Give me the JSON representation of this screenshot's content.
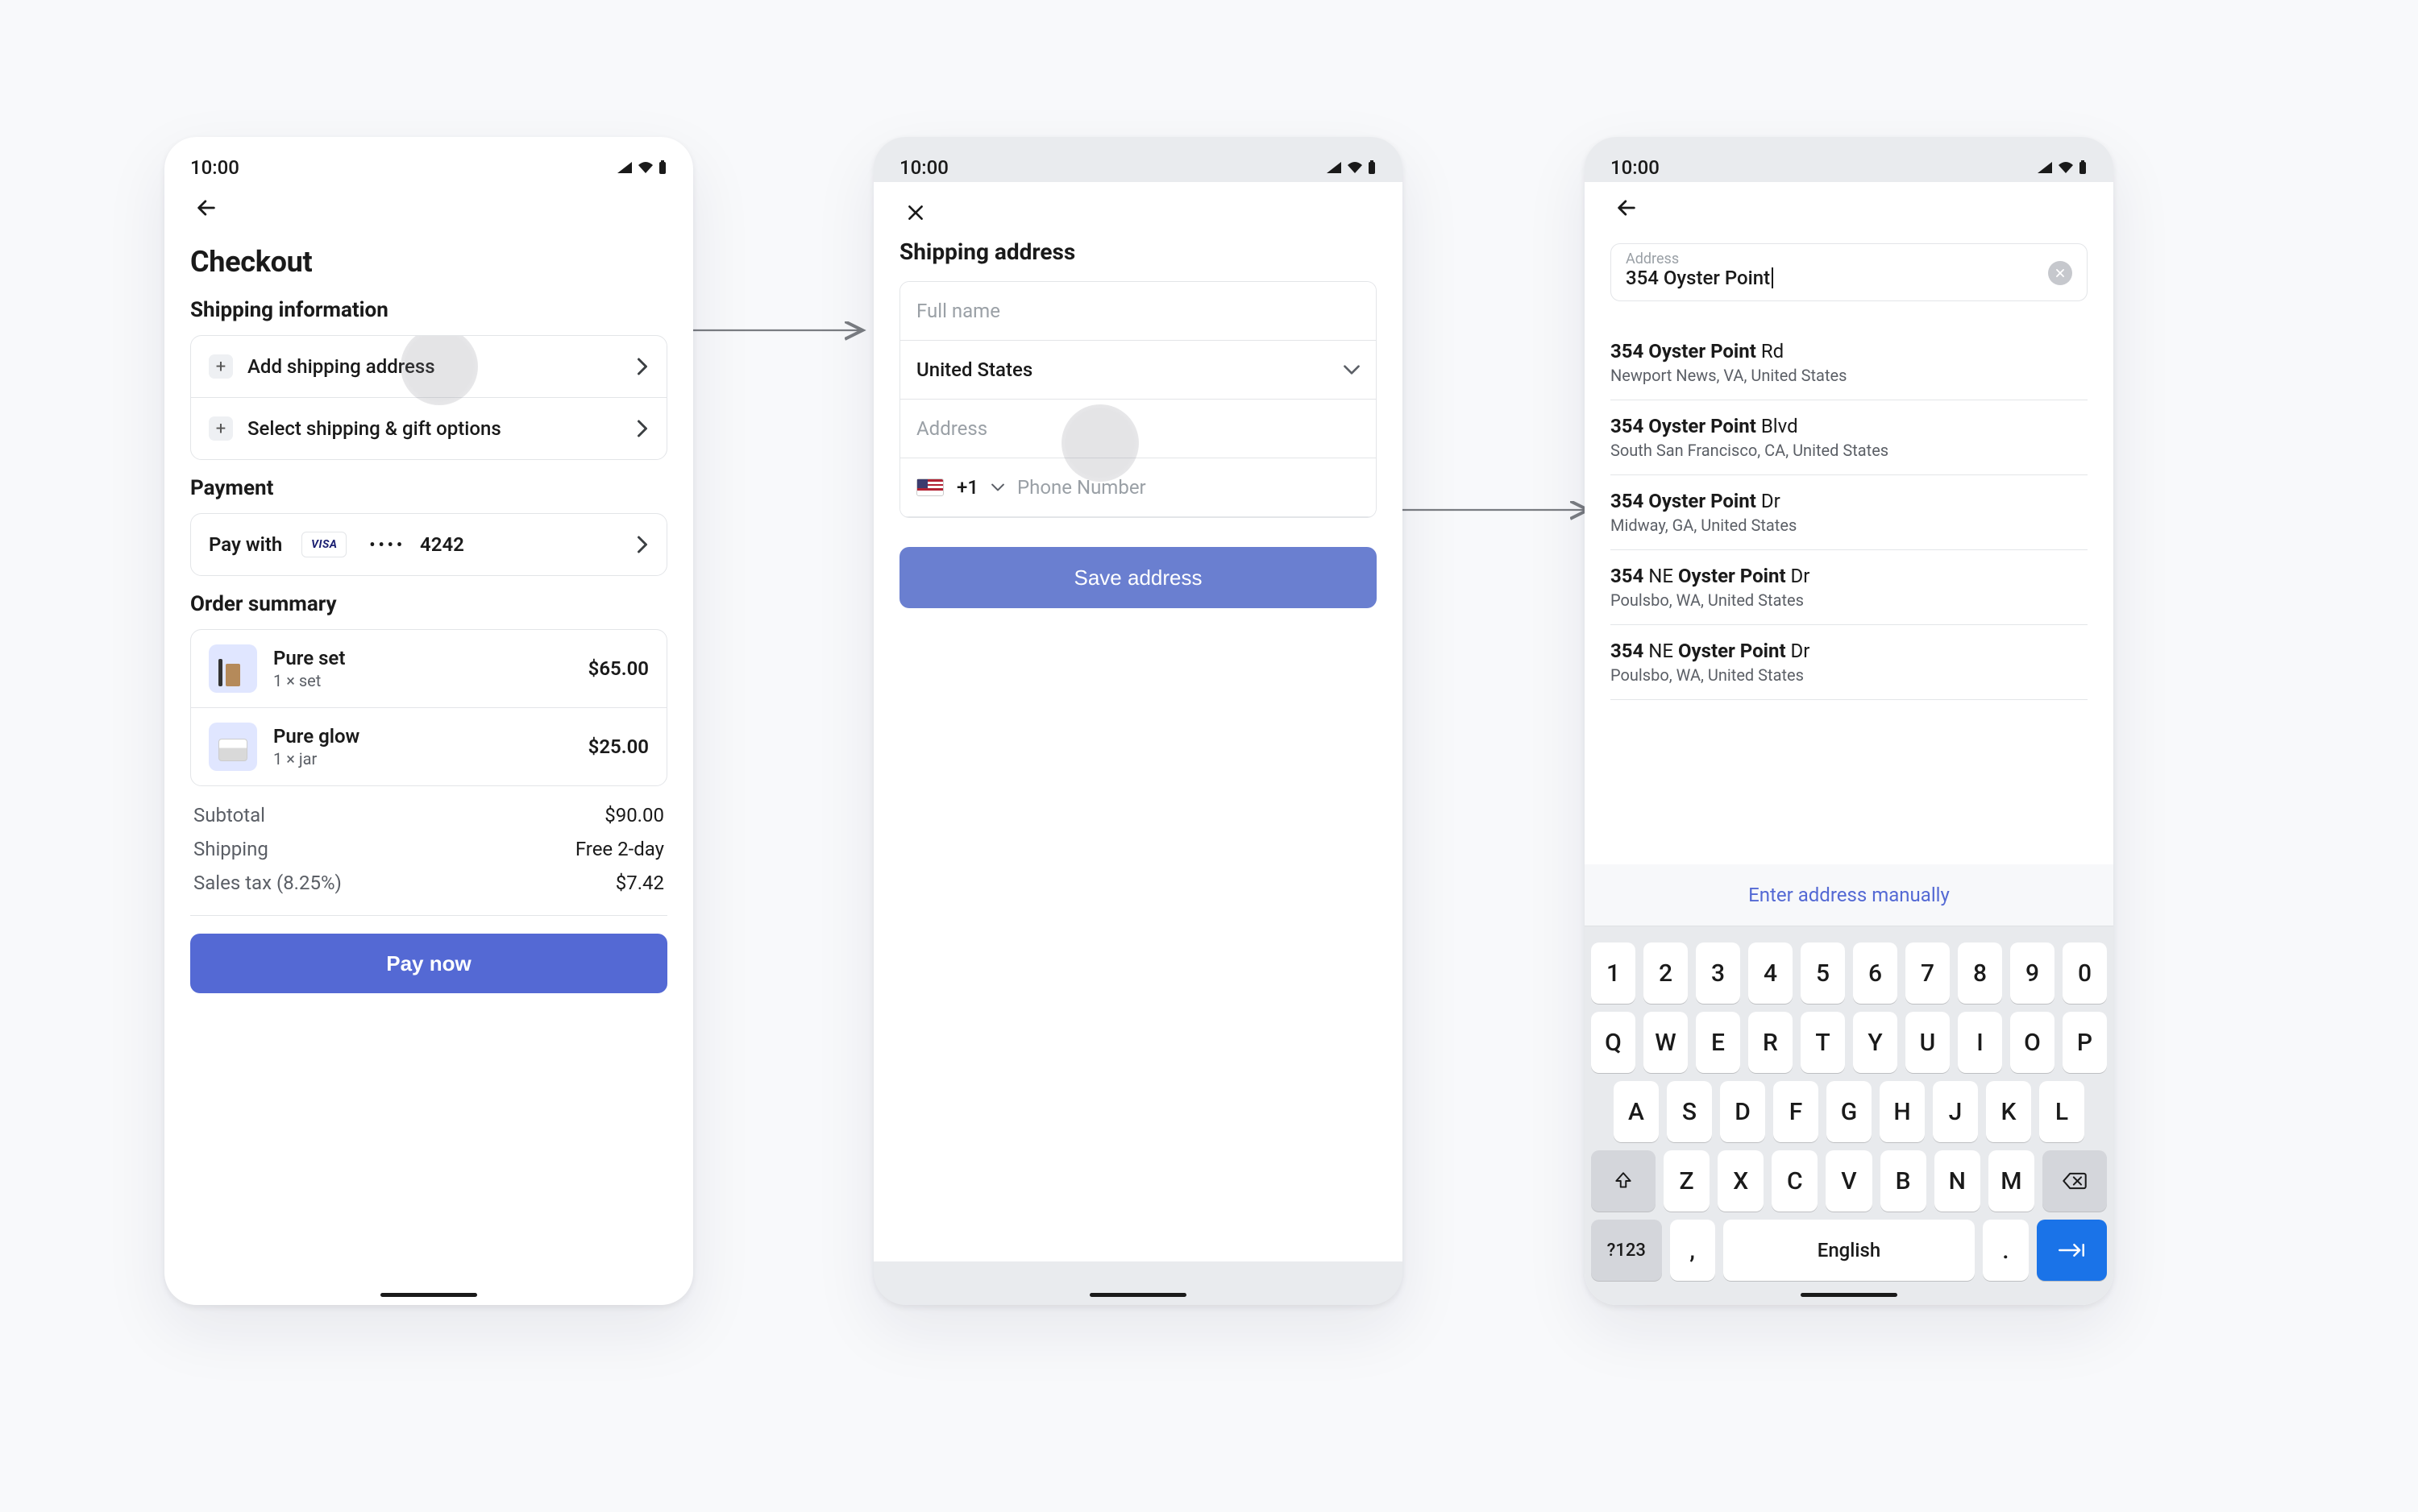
{
  "status_time": "10:00",
  "screen1": {
    "title": "Checkout",
    "shipping_title": "Shipping information",
    "add_address": "Add shipping address",
    "ship_options": "Select shipping & gift options",
    "payment_title": "Payment",
    "pay_with_label": "Pay with",
    "card_brand": "VISA",
    "card_dots": "••••",
    "card_last4": "4242",
    "order_title": "Order summary",
    "items": [
      {
        "name": "Pure set",
        "qty": "1 × set",
        "price": "$65.00"
      },
      {
        "name": "Pure glow",
        "qty": "1 × jar",
        "price": "$25.00"
      }
    ],
    "subtotal_label": "Subtotal",
    "subtotal_value": "$90.00",
    "shipping_label": "Shipping",
    "shipping_value": "Free 2-day",
    "tax_label": "Sales tax (8.25%)",
    "tax_value": "$7.42",
    "pay_button": "Pay now"
  },
  "screen2": {
    "title": "Shipping address",
    "full_name_placeholder": "Full name",
    "country_value": "United States",
    "address_placeholder": "Address",
    "dial_code": "+1",
    "phone_placeholder": "Phone Number",
    "save_button": "Save address"
  },
  "screen3": {
    "input_label": "Address",
    "input_value": "354 Oyster Point",
    "results": [
      {
        "main_bold": "354 Oyster Point",
        "main_rest": " Rd",
        "sub": "Newport News, VA, United States"
      },
      {
        "main_bold": "354 Oyster Point",
        "main_rest": " Blvd",
        "sub": "South San Francisco, CA, United States"
      },
      {
        "main_bold": "354 Oyster Point",
        "main_rest": " Dr",
        "sub": "Midway, GA, United States"
      },
      {
        "main_pre": "354",
        "main_mid": " NE ",
        "main_bold2": "Oyster Point",
        "main_rest": " Dr",
        "sub": "Poulsbo, WA, United States"
      },
      {
        "main_pre": "354",
        "main_mid": " NE ",
        "main_bold2": "Oyster Point",
        "main_rest": " Dr",
        "sub": "Poulsbo, WA, United States"
      }
    ],
    "manual_link": "Enter address manually",
    "keyboard": {
      "row_num": [
        "1",
        "2",
        "3",
        "4",
        "5",
        "6",
        "7",
        "8",
        "9",
        "0"
      ],
      "row1": [
        "Q",
        "W",
        "E",
        "R",
        "T",
        "Y",
        "U",
        "I",
        "O",
        "P"
      ],
      "row2": [
        "A",
        "S",
        "D",
        "F",
        "G",
        "H",
        "J",
        "K",
        "L"
      ],
      "row3": [
        "Z",
        "X",
        "C",
        "V",
        "B",
        "N",
        "M"
      ],
      "sym_key": "?123",
      "comma_key": ",",
      "space_label": "English",
      "period_key": "."
    }
  }
}
